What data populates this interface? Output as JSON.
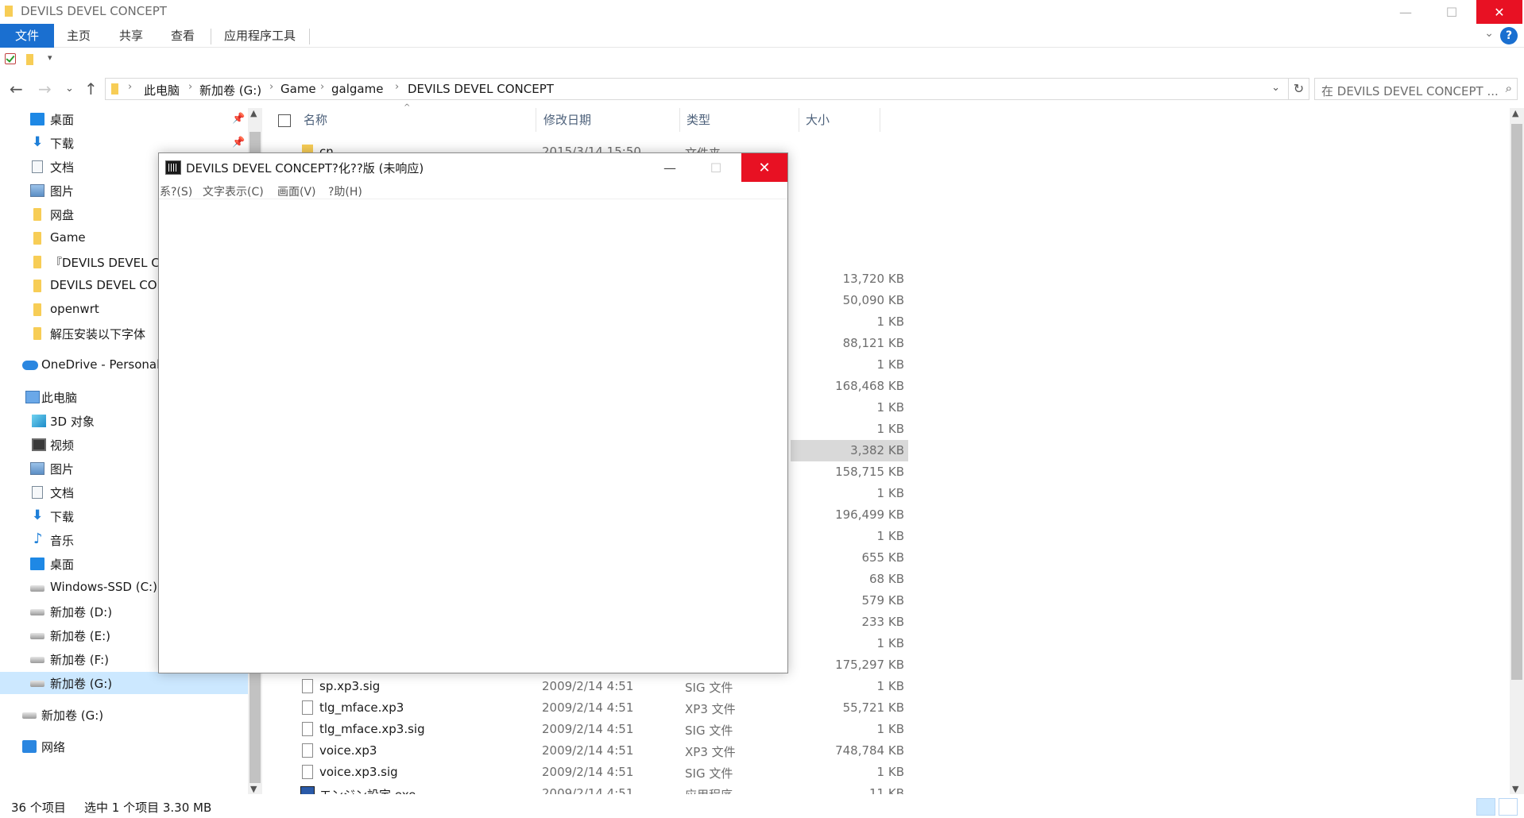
{
  "window": {
    "title": "DEVILS DEVEL CONCEPT"
  },
  "ribbon": {
    "tabs": [
      {
        "label": "文件"
      },
      {
        "label": "主页"
      },
      {
        "label": "共享"
      },
      {
        "label": "查看"
      },
      {
        "label": "应用程序工具"
      }
    ],
    "help": "?"
  },
  "address": {
    "crumbs": [
      "此电脑",
      "新加卷 (G:)",
      "Game",
      "galgame",
      "DEVILS DEVEL CONCEPT"
    ],
    "search_placeholder": "在 DEVILS DEVEL CONCEPT ..."
  },
  "nav": {
    "quick": [
      {
        "label": "桌面",
        "icon": "desktop-icon"
      },
      {
        "label": "下载",
        "icon": "download-icon"
      },
      {
        "label": "文档",
        "icon": "document-icon"
      },
      {
        "label": "图片",
        "icon": "picture-icon"
      },
      {
        "label": "网盘",
        "icon": "folder-icon"
      },
      {
        "label": "Game",
        "icon": "folder-icon"
      },
      {
        "label": "『DEVILS DEVEL CONCEPT",
        "icon": "folder-icon"
      },
      {
        "label": "DEVILS DEVEL CONCEPT",
        "icon": "folder-icon"
      },
      {
        "label": "openwrt",
        "icon": "folder-icon"
      },
      {
        "label": "解压安装以下字体",
        "icon": "folder-icon"
      }
    ],
    "onedrive": "OneDrive - Personal",
    "thispc": "此电脑",
    "pc_items": [
      {
        "label": "3D 对象"
      },
      {
        "label": "视频"
      },
      {
        "label": "图片"
      },
      {
        "label": "文档"
      },
      {
        "label": "下载"
      },
      {
        "label": "音乐"
      },
      {
        "label": "桌面"
      },
      {
        "label": "Windows-SSD (C:)"
      },
      {
        "label": "新加卷 (D:)"
      },
      {
        "label": "新加卷 (E:)"
      },
      {
        "label": "新加卷 (F:)"
      },
      {
        "label": "新加卷 (G:)"
      }
    ],
    "drive_g": "新加卷 (G:)",
    "network": "网络"
  },
  "columns": {
    "name": "名称",
    "date": "修改日期",
    "type": "类型",
    "size": "大小"
  },
  "top_partial": {
    "name": "cn",
    "date": "2015/3/14 15:50",
    "type": "文件夹"
  },
  "hidden_sizes": [
    "13,720 KB",
    "50,090 KB",
    "1 KB",
    "88,121 KB",
    "1 KB",
    "168,468 KB",
    "1 KB",
    "1 KB",
    "3,382 KB",
    "158,715 KB",
    "1 KB",
    "196,499 KB",
    "1 KB",
    "655 KB",
    "68 KB",
    "579 KB",
    "233 KB",
    "1 KB",
    "175,297 KB"
  ],
  "files": [
    {
      "name": "sp.xp3.sig",
      "date": "2009/2/14 4:51",
      "type": "SIG 文件",
      "size": "1 KB"
    },
    {
      "name": "tlg_mface.xp3",
      "date": "2009/2/14 4:51",
      "type": "XP3 文件",
      "size": "55,721 KB"
    },
    {
      "name": "tlg_mface.xp3.sig",
      "date": "2009/2/14 4:51",
      "type": "SIG 文件",
      "size": "1 KB"
    },
    {
      "name": "voice.xp3",
      "date": "2009/2/14 4:51",
      "type": "XP3 文件",
      "size": "748,784 KB"
    },
    {
      "name": "voice.xp3.sig",
      "date": "2009/2/14 4:51",
      "type": "SIG 文件",
      "size": "1 KB"
    }
  ],
  "bottom_partial": {
    "name": "エンジン設定.exe",
    "date": "2009/2/14 4:51",
    "type": "应用程序",
    "size": "11 KB"
  },
  "status": {
    "count": "36 个项目",
    "selection": "选中 1 个项目  3.30 MB"
  },
  "dialog": {
    "title": "DEVILS DEVEL CONCEPT?化??版 (未响应)",
    "menu": [
      "系?(S)",
      "文字表示(C)",
      "画面(V)",
      "?助(H)"
    ]
  }
}
